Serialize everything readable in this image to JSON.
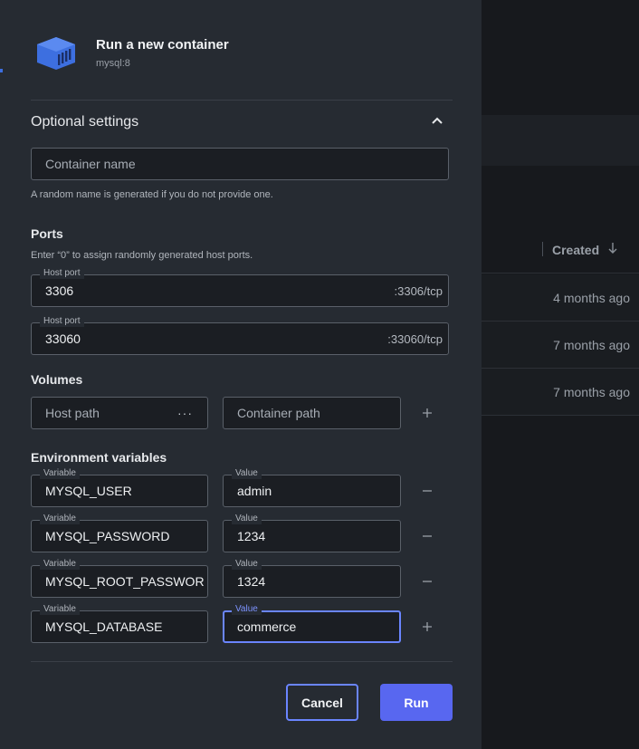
{
  "background": {
    "column_header": "Created",
    "rows": [
      "4 months ago",
      "7 months ago",
      "7 months ago"
    ]
  },
  "dialog": {
    "title": "Run a new container",
    "subtitle": "mysql:8",
    "optional_settings": "Optional settings",
    "container_name": {
      "placeholder": "Container name",
      "helper": "A random name is generated if you do not provide one."
    },
    "ports": {
      "title": "Ports",
      "helper": "Enter “0” to assign randomly generated host ports.",
      "items": [
        {
          "label": "Host port",
          "value": "3306",
          "suffix": ":3306/tcp"
        },
        {
          "label": "Host port",
          "value": "33060",
          "suffix": ":33060/tcp"
        }
      ]
    },
    "volumes": {
      "title": "Volumes",
      "host_path_placeholder": "Host path",
      "browse": "···",
      "container_path_placeholder": "Container path"
    },
    "env": {
      "title": "Environment variables",
      "variable_label": "Variable",
      "value_label": "Value",
      "items": [
        {
          "variable": "MYSQL_USER",
          "value": "admin"
        },
        {
          "variable": "MYSQL_PASSWORD",
          "value": "1234"
        },
        {
          "variable": "MYSQL_ROOT_PASSWOR",
          "value": "1324"
        },
        {
          "variable": "MYSQL_DATABASE",
          "value": "commerce"
        }
      ]
    },
    "buttons": {
      "cancel": "Cancel",
      "run": "Run"
    },
    "colors": {
      "accent": "#5867f0",
      "focus": "#6a85ff",
      "brand": "#3d6fe0"
    }
  }
}
